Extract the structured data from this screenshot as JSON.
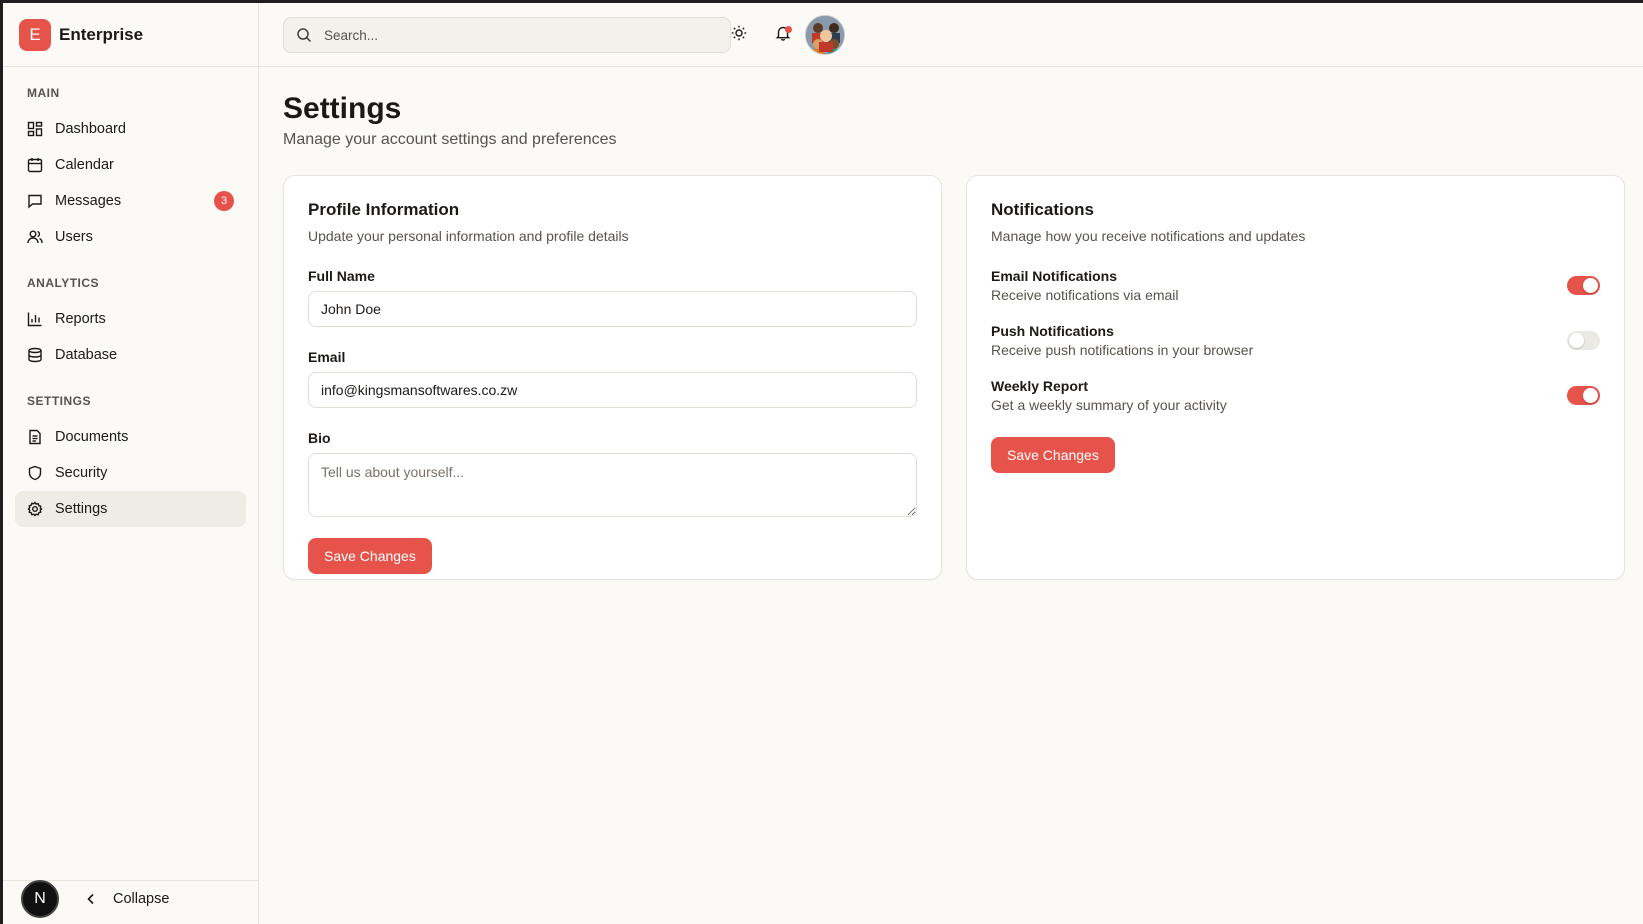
{
  "brand": {
    "logo_letter": "E",
    "name": "Enterprise"
  },
  "sidebar": {
    "sections": [
      {
        "heading": "MAIN",
        "items": [
          {
            "label": "Dashboard",
            "icon": "dashboard-icon"
          },
          {
            "label": "Calendar",
            "icon": "calendar-icon"
          },
          {
            "label": "Messages",
            "icon": "message-icon",
            "badge": "3"
          },
          {
            "label": "Users",
            "icon": "users-icon"
          }
        ]
      },
      {
        "heading": "ANALYTICS",
        "items": [
          {
            "label": "Reports",
            "icon": "bar-chart-icon"
          },
          {
            "label": "Database",
            "icon": "database-icon"
          }
        ]
      },
      {
        "heading": "SETTINGS",
        "items": [
          {
            "label": "Documents",
            "icon": "document-icon"
          },
          {
            "label": "Security",
            "icon": "shield-icon"
          },
          {
            "label": "Settings",
            "icon": "gear-icon",
            "active": true
          }
        ]
      }
    ],
    "footer": {
      "collapse_label": "Collapse",
      "next_badge": "N"
    }
  },
  "header": {
    "search_placeholder": "Search..."
  },
  "main": {
    "title": "Settings",
    "subtitle": "Manage your account settings and preferences",
    "profile": {
      "title": "Profile Information",
      "description": "Update your personal information and profile details",
      "full_name_label": "Full Name",
      "full_name_value": "John Doe",
      "email_label": "Email",
      "email_value": "info@kingsmansoftwares.co.zw",
      "bio_label": "Bio",
      "bio_placeholder": "Tell us about yourself...",
      "save_label": "Save Changes"
    },
    "notifications": {
      "title": "Notifications",
      "description": "Manage how you receive notifications and updates",
      "items": [
        {
          "title": "Email Notifications",
          "description": "Receive notifications via email",
          "enabled": true
        },
        {
          "title": "Push Notifications",
          "description": "Receive push notifications in your browser",
          "enabled": false
        },
        {
          "title": "Weekly Report",
          "description": "Get a weekly summary of your activity",
          "enabled": true
        }
      ],
      "save_label": "Save Changes"
    }
  },
  "colors": {
    "accent": "#e5534b",
    "background": "#fbfaf7"
  }
}
